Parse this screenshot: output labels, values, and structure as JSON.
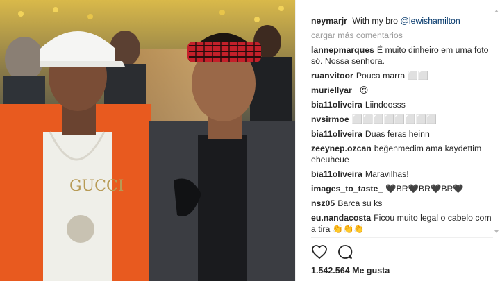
{
  "post": {
    "author": "neymarjr",
    "caption_text": "With my bro",
    "caption_mention": "@lewishamilton",
    "load_more_label": "cargar más comentarios",
    "likes_count": "1.542.564",
    "likes_label": "Me gusta"
  },
  "comments": [
    {
      "user": "lannepmarques",
      "text": "É muito dinheiro em uma foto só. Nossa senhora."
    },
    {
      "user": "ruanvitoor",
      "text": "Pouca marra ⬜⬜"
    },
    {
      "user": "muriellyar_",
      "text": "😍"
    },
    {
      "user": "bia11oliveira",
      "text": "Liindoosss"
    },
    {
      "user": "nvsirmoe",
      "text": "⬜⬜⬜⬜⬜⬜⬜⬜"
    },
    {
      "user": "bia11oliveira",
      "text": "Duas feras heinn"
    },
    {
      "user": "zeeynep.ozcan",
      "text": "beğenmedim ama kaydettim eheuheue"
    },
    {
      "user": "bia11oliveira",
      "text": "Maravilhas!"
    },
    {
      "user": "images_to_taste_",
      "text": "🖤BR🖤BR🖤BR🖤"
    },
    {
      "user": "nsz05",
      "text": "Barca su ks"
    },
    {
      "user": "eu.nandacosta",
      "text": "Ficou muito legal o cabelo com a tira 👏👏👏"
    }
  ],
  "icons": {
    "like": "heart-icon",
    "comment": "comment-bubble-icon"
  },
  "colors": {
    "username": "#262626",
    "mention": "#003569",
    "muted": "#999999",
    "jacket_orange": "#e85a1f",
    "bandana_red": "#c4202a"
  }
}
